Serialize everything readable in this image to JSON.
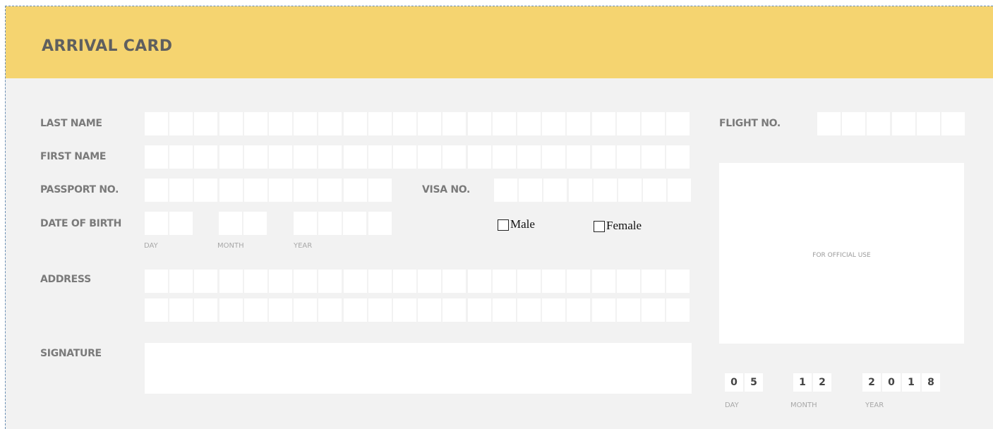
{
  "title": "ARRIVAL CARD",
  "labels": {
    "last_name": "LAST NAME",
    "first_name": "FIRST NAME",
    "passport_no": "PASSPORT NO.",
    "visa_no": "VISA NO.",
    "date_of_birth": "DATE OF BIRTH",
    "address": "ADDRESS",
    "signature": "SIGNATURE",
    "flight_no": "FLIGHT NO."
  },
  "dob_sublabels": {
    "day": "DAY",
    "month": "MONTH",
    "year": "YEAR"
  },
  "gender": {
    "male": "Male",
    "female": "Female"
  },
  "official_use": "FOR OFFICIAL USE",
  "date": {
    "day": [
      "0",
      "5"
    ],
    "month": [
      "1",
      "2"
    ],
    "year": [
      "2",
      "0",
      "1",
      "8"
    ],
    "labels": {
      "day": "DAY",
      "month": "MONTH",
      "year": "YEAR"
    }
  },
  "colors": {
    "header": "#f5d470",
    "background": "#f2f2f2",
    "field": "#ffffff"
  }
}
